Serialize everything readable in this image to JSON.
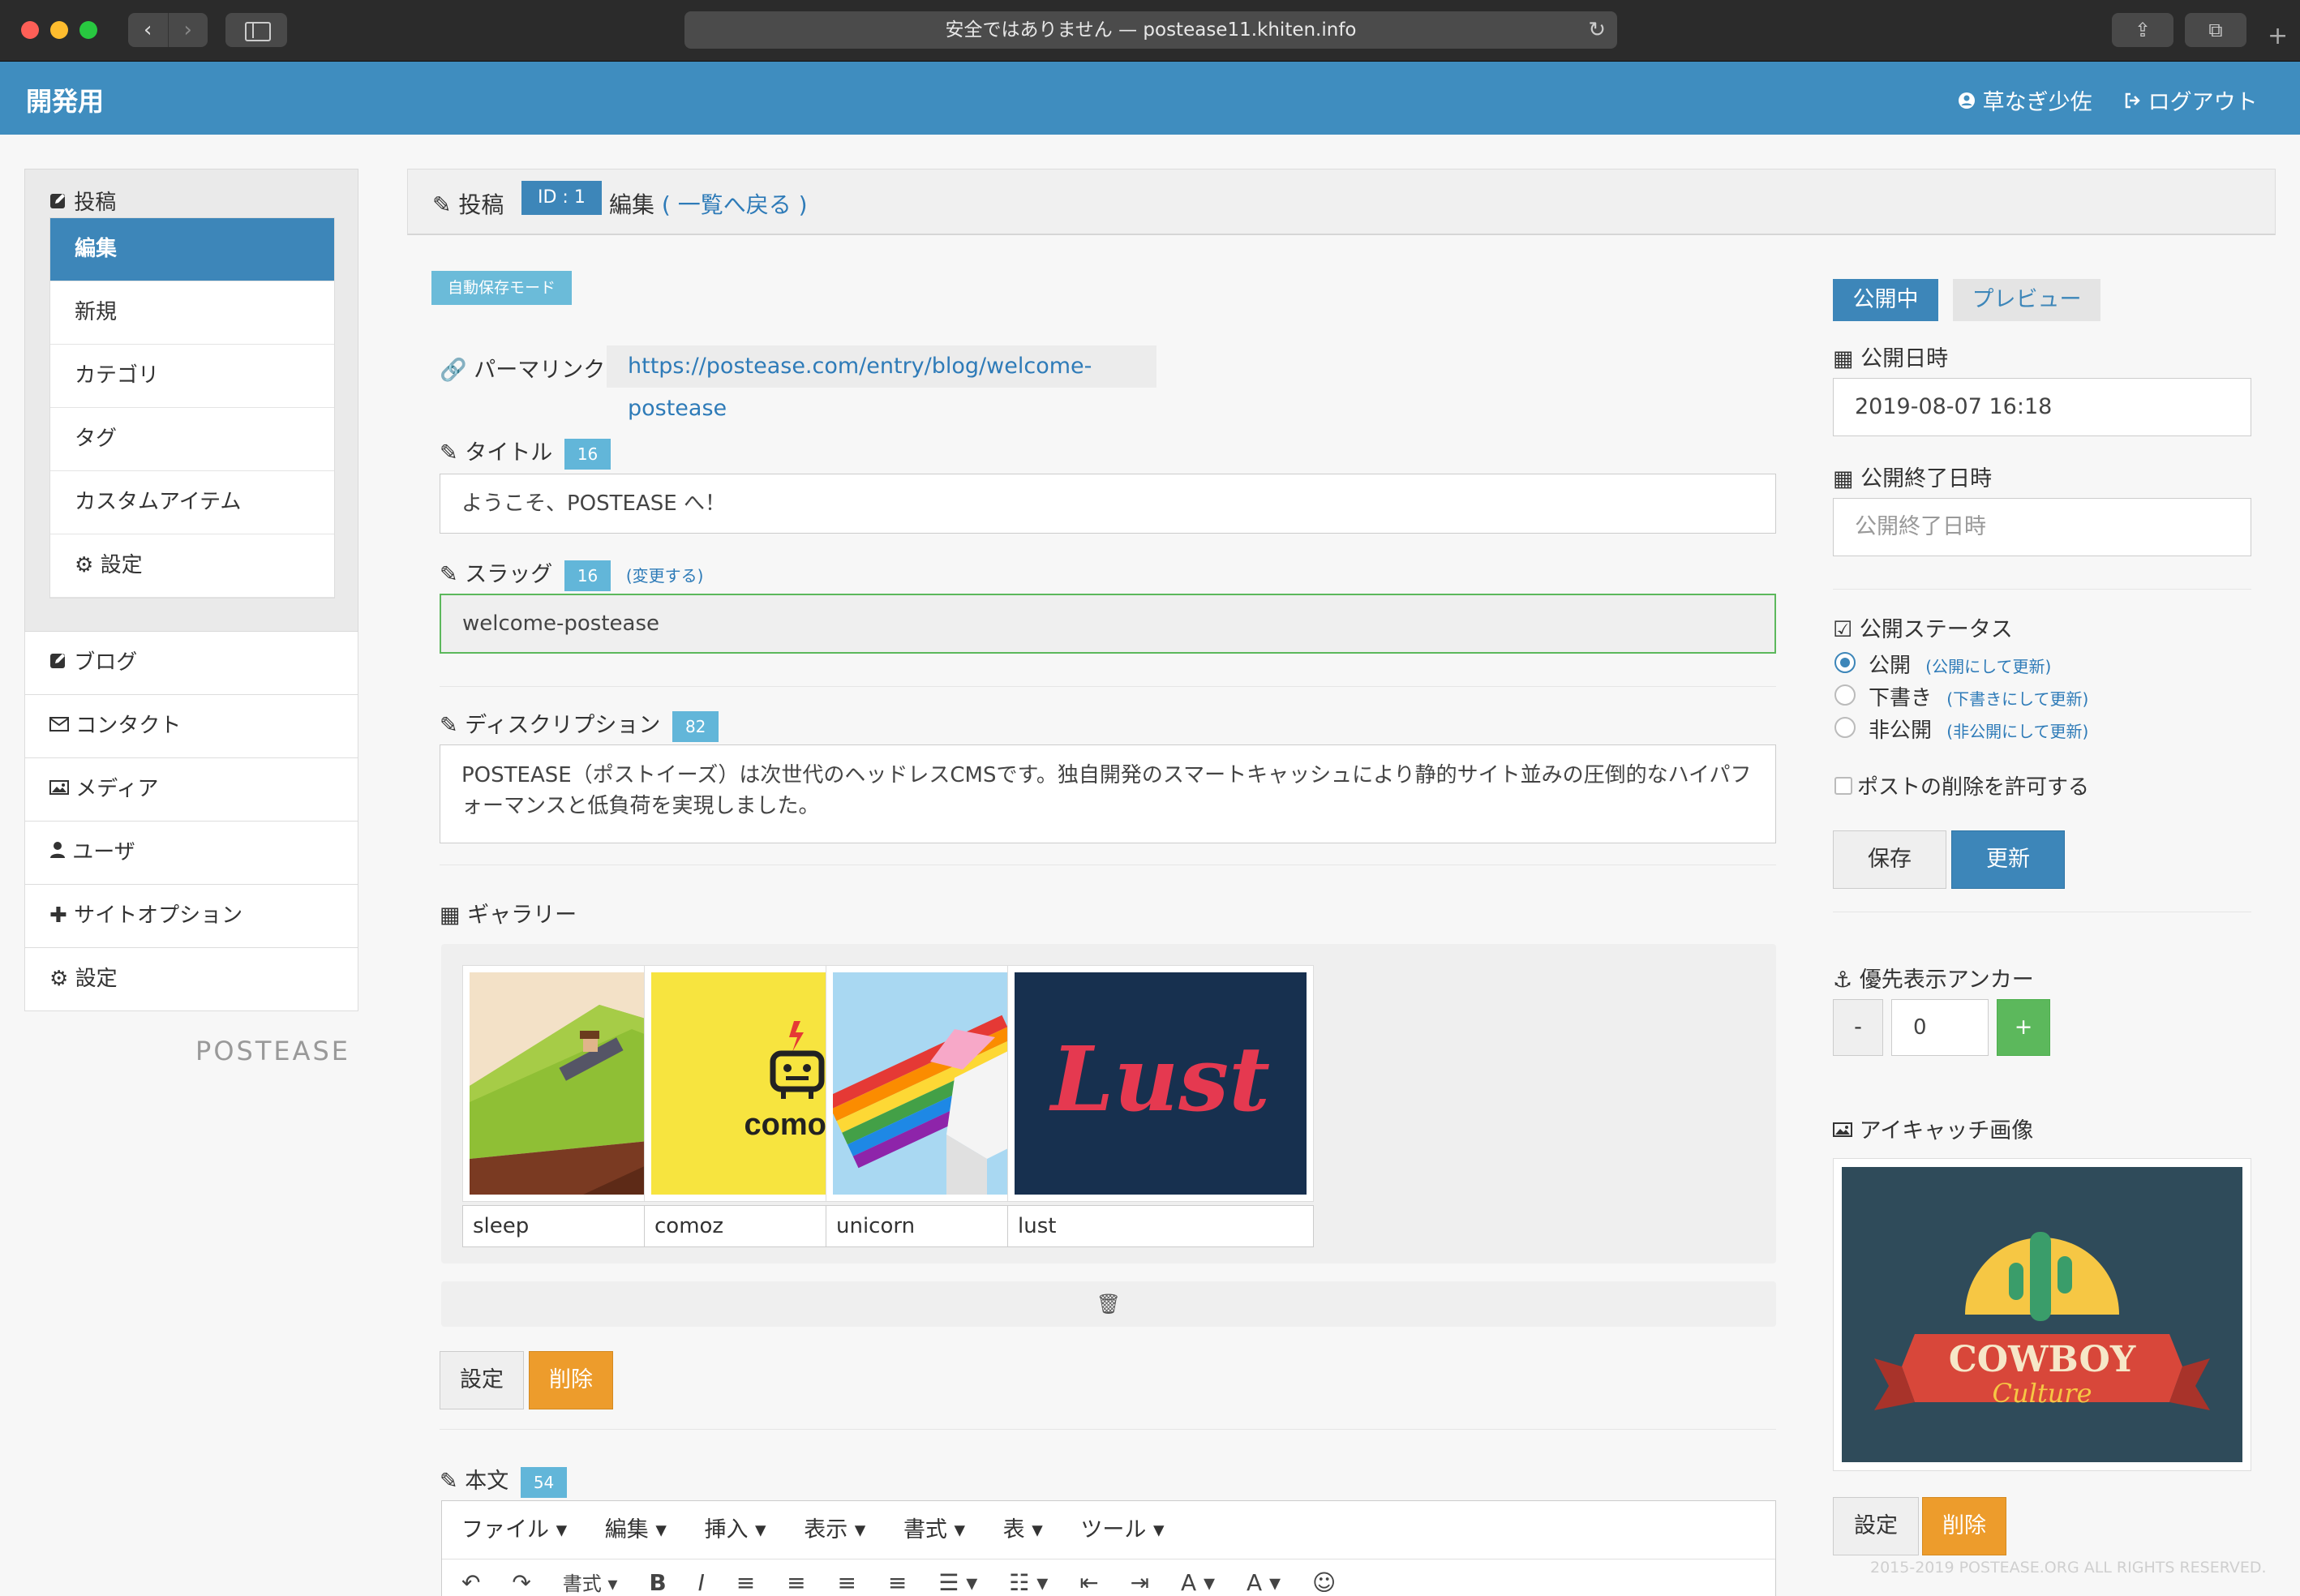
{
  "browser": {
    "url_text": "安全ではありません — postease11.khiten.info",
    "reload_icon": "↻",
    "share_icon": "⇪",
    "tabs_icon": "⧉",
    "plus_icon": "+",
    "back_icon": "‹",
    "forward_icon": "›"
  },
  "header": {
    "brand": "開発用",
    "user": "草なぎ少佐",
    "logout": "ログアウト"
  },
  "sidebar": {
    "group_title": "投稿",
    "sub_items": [
      {
        "label": "編集"
      },
      {
        "label": "新規"
      },
      {
        "label": "カテゴリ"
      },
      {
        "label": "タグ"
      },
      {
        "label": "カスタムアイテム"
      },
      {
        "label": "設定"
      }
    ],
    "items": [
      {
        "label": "ブログ"
      },
      {
        "label": "コンタクト"
      },
      {
        "label": "メディア"
      },
      {
        "label": "ユーザ"
      },
      {
        "label": "サイトオプション"
      },
      {
        "label": "設定"
      }
    ],
    "logo": "POSTEASE"
  },
  "main": {
    "section": "投稿",
    "id_badge": "ID : 1",
    "edit": "編集",
    "back_link": "( 一覧へ戻る )",
    "autosave": "自動保存モード",
    "permalink_label": "パーマリンク :",
    "permalink_url": "https://postease.com/entry/blog/welcome-postease",
    "title_label": "タイトル",
    "title_count": "16",
    "title_value": "ようこそ、POSTEASE へ！",
    "slug_label": "スラッグ",
    "slug_count": "16",
    "slug_change": "(変更する)",
    "slug_value": "welcome-postease",
    "description_label": "ディスクリプション",
    "description_count": "82",
    "description_value": "POSTEASE（ポストイーズ）は次世代のヘッドレスCMSです。独自開発のスマートキャッシュにより静的サイト並みの圧倒的なハイパフォーマンスと低負荷を実現しました。",
    "gallery_label": "ギャラリー",
    "gallery": [
      {
        "caption": "sleep"
      },
      {
        "caption": "comoz"
      },
      {
        "caption": "unicorn"
      },
      {
        "caption": "lust"
      }
    ],
    "gallery_image_text": {
      "comoz": "comoz.",
      "lust": "Lust"
    },
    "trash_icon": "🗑",
    "settings_button": "設定",
    "delete_button": "削除",
    "body_label": "本文",
    "body_count": "54",
    "editor_menu": [
      "ファイル ▾",
      "編集 ▾",
      "挿入 ▾",
      "表示 ▾",
      "書式 ▾",
      "表 ▾",
      "ツール ▾"
    ],
    "editor_toolbar": [
      "↶",
      "↷",
      "書式 ▾",
      "B",
      "I",
      "≡",
      "≡",
      "≡",
      "≡",
      "☰ ▾",
      "☷ ▾",
      "⇤",
      "⇥",
      "A ▾",
      "A ▾",
      "☺"
    ]
  },
  "right": {
    "status_published": "公開中",
    "preview": "プレビュー",
    "publish_date_label": "公開日時",
    "publish_date": "2019-08-07 16:18",
    "end_date_label": "公開終了日時",
    "end_date_placeholder": "公開終了日時",
    "status_label": "公開ステータス",
    "status_options": [
      {
        "label": "公開",
        "action": "(公開にして更新)",
        "selected": true
      },
      {
        "label": "下書き",
        "action": "(下書きにして更新)",
        "selected": false
      },
      {
        "label": "非公開",
        "action": "(非公開にして更新)",
        "selected": false
      }
    ],
    "allow_delete": "ポストの削除を許可する",
    "save_button": "保存",
    "update_button": "更新",
    "anchor_label": "優先表示アンカー",
    "anchor_minus": "-",
    "anchor_value": "0",
    "anchor_plus": "+",
    "eyecatch_label": "アイキャッチ画像",
    "eyecatch_text": {
      "line1": "COWBOY",
      "line2": "Culture"
    },
    "eyecatch_settings": "設定",
    "eyecatch_delete": "削除",
    "copyright": "2015-2019 POSTEASE.ORG ALL RIGHTS RESERVED."
  },
  "colors": {
    "brand_blue": "#3d86b9",
    "header_blue": "#3f8dbf",
    "badge_cyan": "#62b6d9",
    "orange": "#ed9c2c",
    "green": "#5cb85c"
  }
}
